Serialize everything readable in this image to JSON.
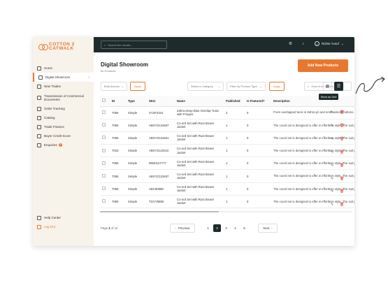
{
  "brand": {
    "line1": "COTTON 2",
    "line2": "CATWALK",
    "color": "#e8772e"
  },
  "topbar": {
    "search_placeholder": "Search the results...",
    "user_name": "Rishin Yusuf"
  },
  "sidebar": {
    "items": [
      {
        "label": "Home",
        "icon": "home-icon"
      },
      {
        "label": "Digital Showroom",
        "icon": "showroom-icon",
        "active": true
      },
      {
        "label": "New Trades",
        "icon": "trades-icon"
      },
      {
        "label": "Transmission of Commercial Documents",
        "icon": "documents-icon"
      },
      {
        "label": "Order Tracking",
        "icon": "tracking-icon"
      },
      {
        "label": "Catalog",
        "icon": "catalog-icon"
      },
      {
        "label": "Trade Finance",
        "icon": "finance-icon"
      },
      {
        "label": "Buyer Credit Score",
        "icon": "credit-icon"
      },
      {
        "label": "Enquiries",
        "icon": "enquiries-icon",
        "badge": "3"
      }
    ],
    "help": "Help Center",
    "logout": "Log Out"
  },
  "page": {
    "title": "Digital Showroom",
    "subtitle": "50 Products",
    "add_button": "Add New Products"
  },
  "filters": {
    "bulk_actions": "Bulk Actions",
    "apply1": "Apply",
    "category": "Select a Category",
    "product_type": "Filter by Product Type",
    "apply2": "Apply",
    "search_placeholder": "Search for results...",
    "tooltip": "Show as Grid"
  },
  "table": {
    "headers": [
      "ID",
      "Type",
      "SKU",
      "Name",
      "Published",
      "Is Featured?",
      "Description"
    ],
    "rows": [
      {
        "id": "7055",
        "type": "Simple",
        "sku": "XYZF2341",
        "name": "Zahra Deep Blue Overlap Tunic with Fringes",
        "published": "2",
        "featured": "0",
        "desc": "From overlapped tunic is Zahra pri and embroidered buttons. At kle a"
      },
      {
        "id": "7055",
        "type": "Simple",
        "sku": "ABXYZ123457",
        "name": "Co-ord Set with Rust Brown Jacket",
        "published": "1",
        "featured": "0",
        "desc": "The coord set is designed to offer w effortless style. The suit jacket com"
      },
      {
        "id": "7055",
        "type": "Simple",
        "sku": "ABXYZ123461",
        "name": "Co-ord Set with Rust Brown Jacket",
        "published": "1",
        "featured": "0",
        "desc": "The coord set is designed to offer w effortless style. The suit jacket com"
      },
      {
        "id": "7015",
        "type": "Simple",
        "sku": "ABXYZ123410",
        "name": "Co-ord Set with Rust Brown Jacket",
        "published": "1",
        "featured": "0",
        "desc": "The coord set is designed to offer w effortless style. The suit jacket com"
      },
      {
        "id": "7055",
        "type": "Simple",
        "sku": "WWHUI7777",
        "name": "Co-ord Set with Rust Brown Jacket",
        "published": "1",
        "featured": "0",
        "desc": "The coord set is designed to offer w effortless style. The suit jacket com"
      },
      {
        "id": "7055",
        "type": "Simple",
        "sku": "ABXYZ123457",
        "name": "Co-ord Set with Rust Brown Jacket",
        "published": "1",
        "featured": "0",
        "desc": "The coord set is designed to offer w effortless style. The suit jacket com"
      },
      {
        "id": "7055",
        "type": "Simple",
        "sku": "ABC90988",
        "name": "Co-ord Set with Rust Brown Jacket",
        "published": "1",
        "featured": "0",
        "desc": "The coord set is designed to offer w effortless style. The suit jacket com"
      },
      {
        "id": "7055",
        "type": "Simple",
        "sku": "TGVY8890",
        "name": "Co-ord Set with Rust Brown Jacket",
        "published": "1",
        "featured": "0",
        "desc": "The coord set is designed to offer w effortless style. The suit jacket com"
      }
    ]
  },
  "pagination": {
    "page_label": "Page",
    "current": "1",
    "of_label": "of",
    "total": "10",
    "previous": "Previous",
    "next": "Next",
    "pages": [
      "1",
      "2",
      "3",
      "4",
      "5"
    ],
    "active_page": "2"
  }
}
